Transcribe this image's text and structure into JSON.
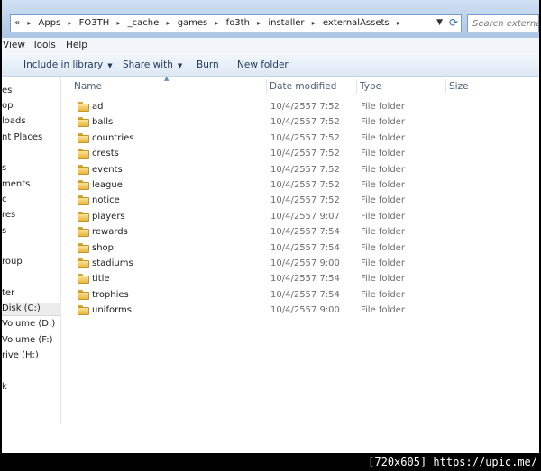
{
  "address": {
    "prefix": "«",
    "crumbs": [
      "Apps",
      "FO3TH",
      "_cache",
      "games",
      "fo3th",
      "installer",
      "externalAssets"
    ],
    "separator": "▸"
  },
  "search": {
    "placeholder": "Search externalA"
  },
  "menu": [
    "View",
    "Tools",
    "Help"
  ],
  "toolbar": {
    "include_label": "Include in library",
    "share_label": "Share with",
    "burn_label": "Burn",
    "new_folder_label": "New folder"
  },
  "nav": [
    {
      "label": "es",
      "selected": false
    },
    {
      "label": "op",
      "selected": false
    },
    {
      "label": "loads",
      "selected": false
    },
    {
      "label": "nt Places",
      "selected": false
    },
    {
      "label": "",
      "selected": false
    },
    {
      "label": "s",
      "selected": false
    },
    {
      "label": "ments",
      "selected": false
    },
    {
      "label": "c",
      "selected": false
    },
    {
      "label": "res",
      "selected": false
    },
    {
      "label": "s",
      "selected": false
    },
    {
      "label": "",
      "selected": false
    },
    {
      "label": "roup",
      "selected": false
    },
    {
      "label": "",
      "selected": false
    },
    {
      "label": "ter",
      "selected": false
    },
    {
      "label": " Disk (C:)",
      "selected": true
    },
    {
      "label": " Volume (D:)",
      "selected": false
    },
    {
      "label": " Volume (F:)",
      "selected": false
    },
    {
      "label": "rive (H:)",
      "selected": false
    },
    {
      "label": "",
      "selected": false
    },
    {
      "label": "k",
      "selected": false
    }
  ],
  "columns": {
    "name": "Name",
    "date": "Date modified",
    "type": "Type",
    "size": "Size"
  },
  "files": [
    {
      "name": "ad",
      "date": "10/4/2557 7:52",
      "type": "File folder"
    },
    {
      "name": "balls",
      "date": "10/4/2557 7:52",
      "type": "File folder"
    },
    {
      "name": "countries",
      "date": "10/4/2557 7:52",
      "type": "File folder"
    },
    {
      "name": "crests",
      "date": "10/4/2557 7:52",
      "type": "File folder"
    },
    {
      "name": "events",
      "date": "10/4/2557 7:52",
      "type": "File folder"
    },
    {
      "name": "league",
      "date": "10/4/2557 7:52",
      "type": "File folder"
    },
    {
      "name": "notice",
      "date": "10/4/2557 7:52",
      "type": "File folder"
    },
    {
      "name": "players",
      "date": "10/4/2557 9:07",
      "type": "File folder"
    },
    {
      "name": "rewards",
      "date": "10/4/2557 7:54",
      "type": "File folder"
    },
    {
      "name": "shop",
      "date": "10/4/2557 7:54",
      "type": "File folder"
    },
    {
      "name": "stadiums",
      "date": "10/4/2557 9:00",
      "type": "File folder"
    },
    {
      "name": "title",
      "date": "10/4/2557 7:54",
      "type": "File folder"
    },
    {
      "name": "trophies",
      "date": "10/4/2557 7:54",
      "type": "File folder"
    },
    {
      "name": "uniforms",
      "date": "10/4/2557 9:00",
      "type": "File folder"
    }
  ],
  "watermark": "[720x605] https://upic.me/"
}
